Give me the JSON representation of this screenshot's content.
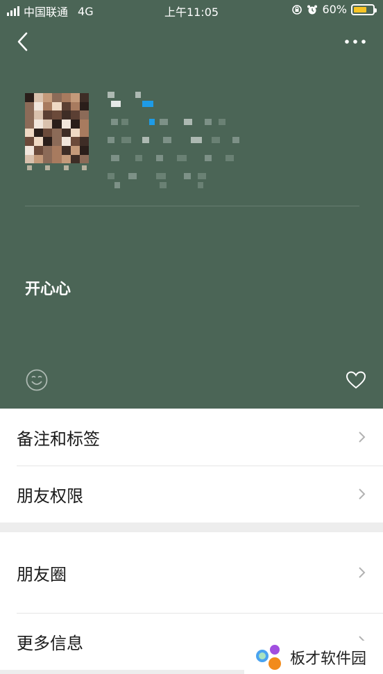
{
  "status_bar": {
    "carrier": "中国联通",
    "network": "4G",
    "time": "上午11:05",
    "battery": "60%",
    "battery_level": 0.6,
    "battery_color": "#f7c425"
  },
  "header": {
    "background": "#4b6556",
    "back_icon": "chevron-left-icon",
    "more_icon": "more-dots-icon",
    "signature": "开心心",
    "emoji_icon": "smile-icon",
    "like_icon": "heart-icon"
  },
  "menu_group_1": [
    {
      "label": "备注和标签"
    },
    {
      "label": "朋友权限"
    }
  ],
  "menu_group_2": [
    {
      "label": "朋友圈"
    },
    {
      "label": "更多信息"
    }
  ],
  "watermark": {
    "text": "板才软件园"
  }
}
